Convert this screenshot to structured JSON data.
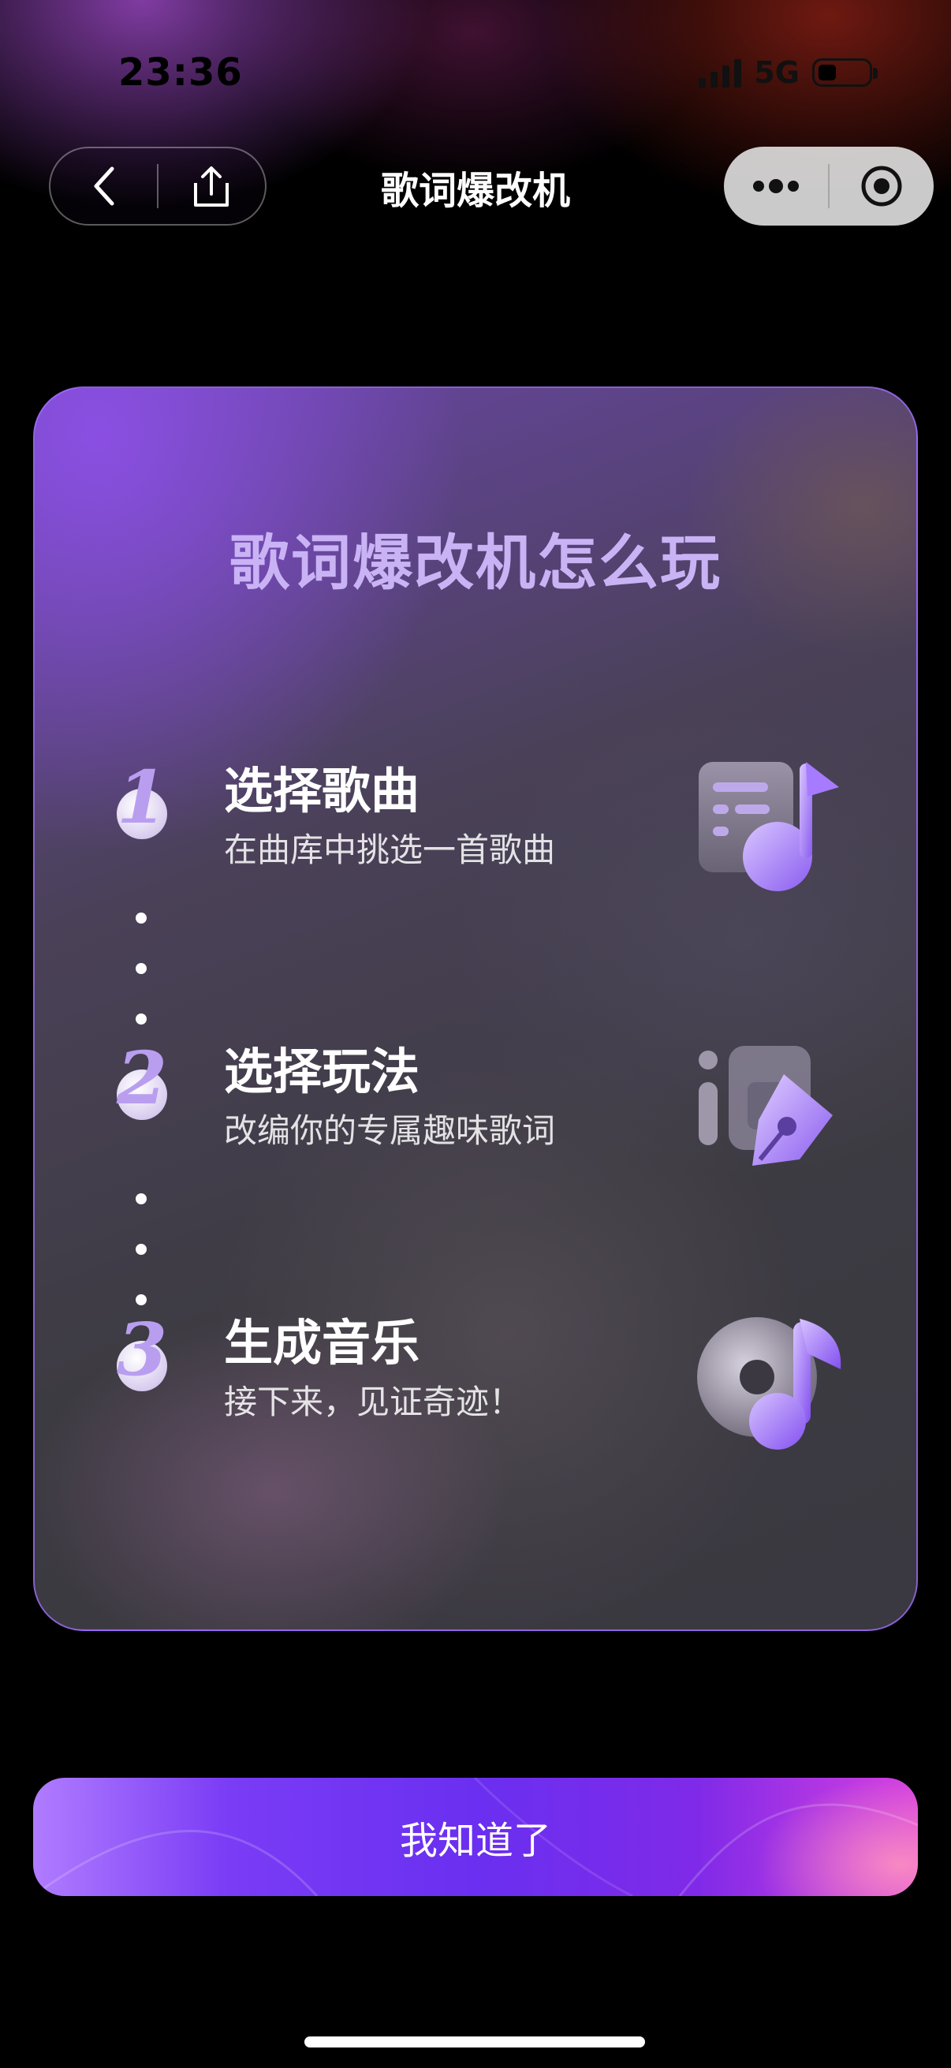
{
  "status_bar": {
    "time": "23:36",
    "network": "5G"
  },
  "nav": {
    "title": "歌词爆改机"
  },
  "card": {
    "title": "歌词爆改机怎么玩",
    "steps": [
      {
        "number": "1",
        "title": "选择歌曲",
        "desc": "在曲库中挑选一首歌曲",
        "icon": "music-playlist-icon"
      },
      {
        "number": "2",
        "title": "选择玩法",
        "desc": "改编你的专属趣味歌词",
        "icon": "lyrics-pen-icon"
      },
      {
        "number": "3",
        "title": "生成音乐",
        "desc": "接下来，见证奇迹！",
        "icon": "music-disc-icon"
      }
    ]
  },
  "confirm_button": {
    "label": "我知道了"
  },
  "colors": {
    "accent": "#7a3cf5",
    "card_title": "#c9b3f5",
    "card_border": "#a06eff"
  }
}
